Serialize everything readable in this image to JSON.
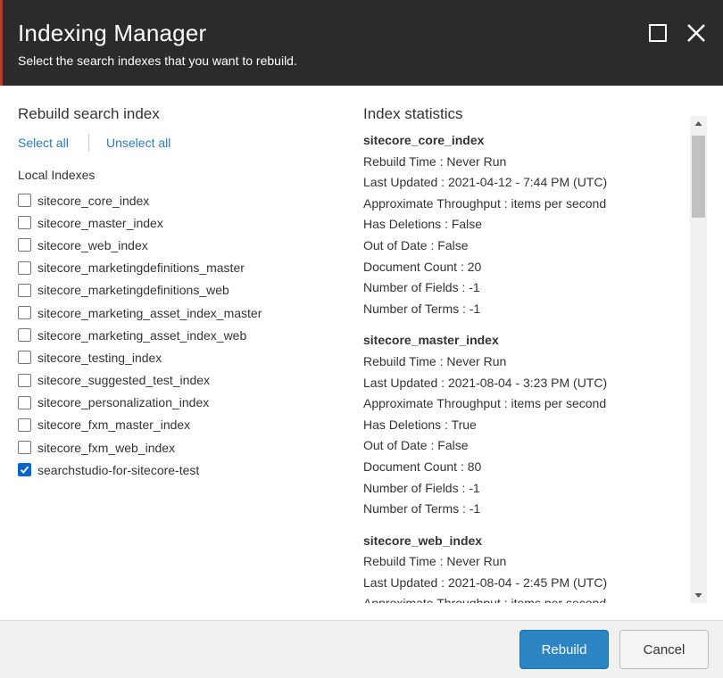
{
  "dialog": {
    "title": "Indexing Manager",
    "subtitle": "Select the search indexes that you want to rebuild."
  },
  "left": {
    "heading": "Rebuild search index",
    "select_all": "Select all",
    "unselect_all": "Unselect all",
    "group_label": "Local Indexes",
    "indexes": [
      {
        "name": "sitecore_core_index",
        "checked": false
      },
      {
        "name": "sitecore_master_index",
        "checked": false
      },
      {
        "name": "sitecore_web_index",
        "checked": false
      },
      {
        "name": "sitecore_marketingdefinitions_master",
        "checked": false
      },
      {
        "name": "sitecore_marketingdefinitions_web",
        "checked": false
      },
      {
        "name": "sitecore_marketing_asset_index_master",
        "checked": false
      },
      {
        "name": "sitecore_marketing_asset_index_web",
        "checked": false
      },
      {
        "name": "sitecore_testing_index",
        "checked": false
      },
      {
        "name": "sitecore_suggested_test_index",
        "checked": false
      },
      {
        "name": "sitecore_personalization_index",
        "checked": false
      },
      {
        "name": "sitecore_fxm_master_index",
        "checked": false
      },
      {
        "name": "sitecore_fxm_web_index",
        "checked": false
      },
      {
        "name": "searchstudio-for-sitecore-test",
        "checked": true
      }
    ]
  },
  "right": {
    "heading": "Index statistics",
    "stats": [
      {
        "name": "sitecore_core_index",
        "lines": [
          "Rebuild Time : Never Run",
          "Last Updated : 2021-04-12 - 7:44 PM (UTC)",
          "Approximate Throughput : items per second",
          "Has Deletions : False",
          "Out of Date : False",
          "Document Count : 20",
          "Number of Fields : -1",
          "Number of Terms : -1"
        ]
      },
      {
        "name": "sitecore_master_index",
        "lines": [
          "Rebuild Time : Never Run",
          "Last Updated : 2021-08-04 - 3:23 PM (UTC)",
          "Approximate Throughput : items per second",
          "Has Deletions : True",
          "Out of Date : False",
          "Document Count : 80",
          "Number of Fields : -1",
          "Number of Terms : -1"
        ]
      },
      {
        "name": "sitecore_web_index",
        "lines": [
          "Rebuild Time : Never Run",
          "Last Updated : 2021-08-04 - 2:45 PM (UTC)",
          "Approximate Throughput : items per second"
        ]
      }
    ]
  },
  "footer": {
    "rebuild_label": "Rebuild",
    "cancel_label": "Cancel"
  },
  "colors": {
    "titlebar": "#2b2b2b",
    "link": "#2b7bb9",
    "primary_button": "#2b85c3",
    "checkbox_checked": "#0b63ce"
  },
  "icons": {
    "maximize": "maximize-icon",
    "close": "close-icon",
    "check": "check-icon",
    "scroll_up": "triangle-up-icon",
    "scroll_down": "triangle-down-icon"
  }
}
